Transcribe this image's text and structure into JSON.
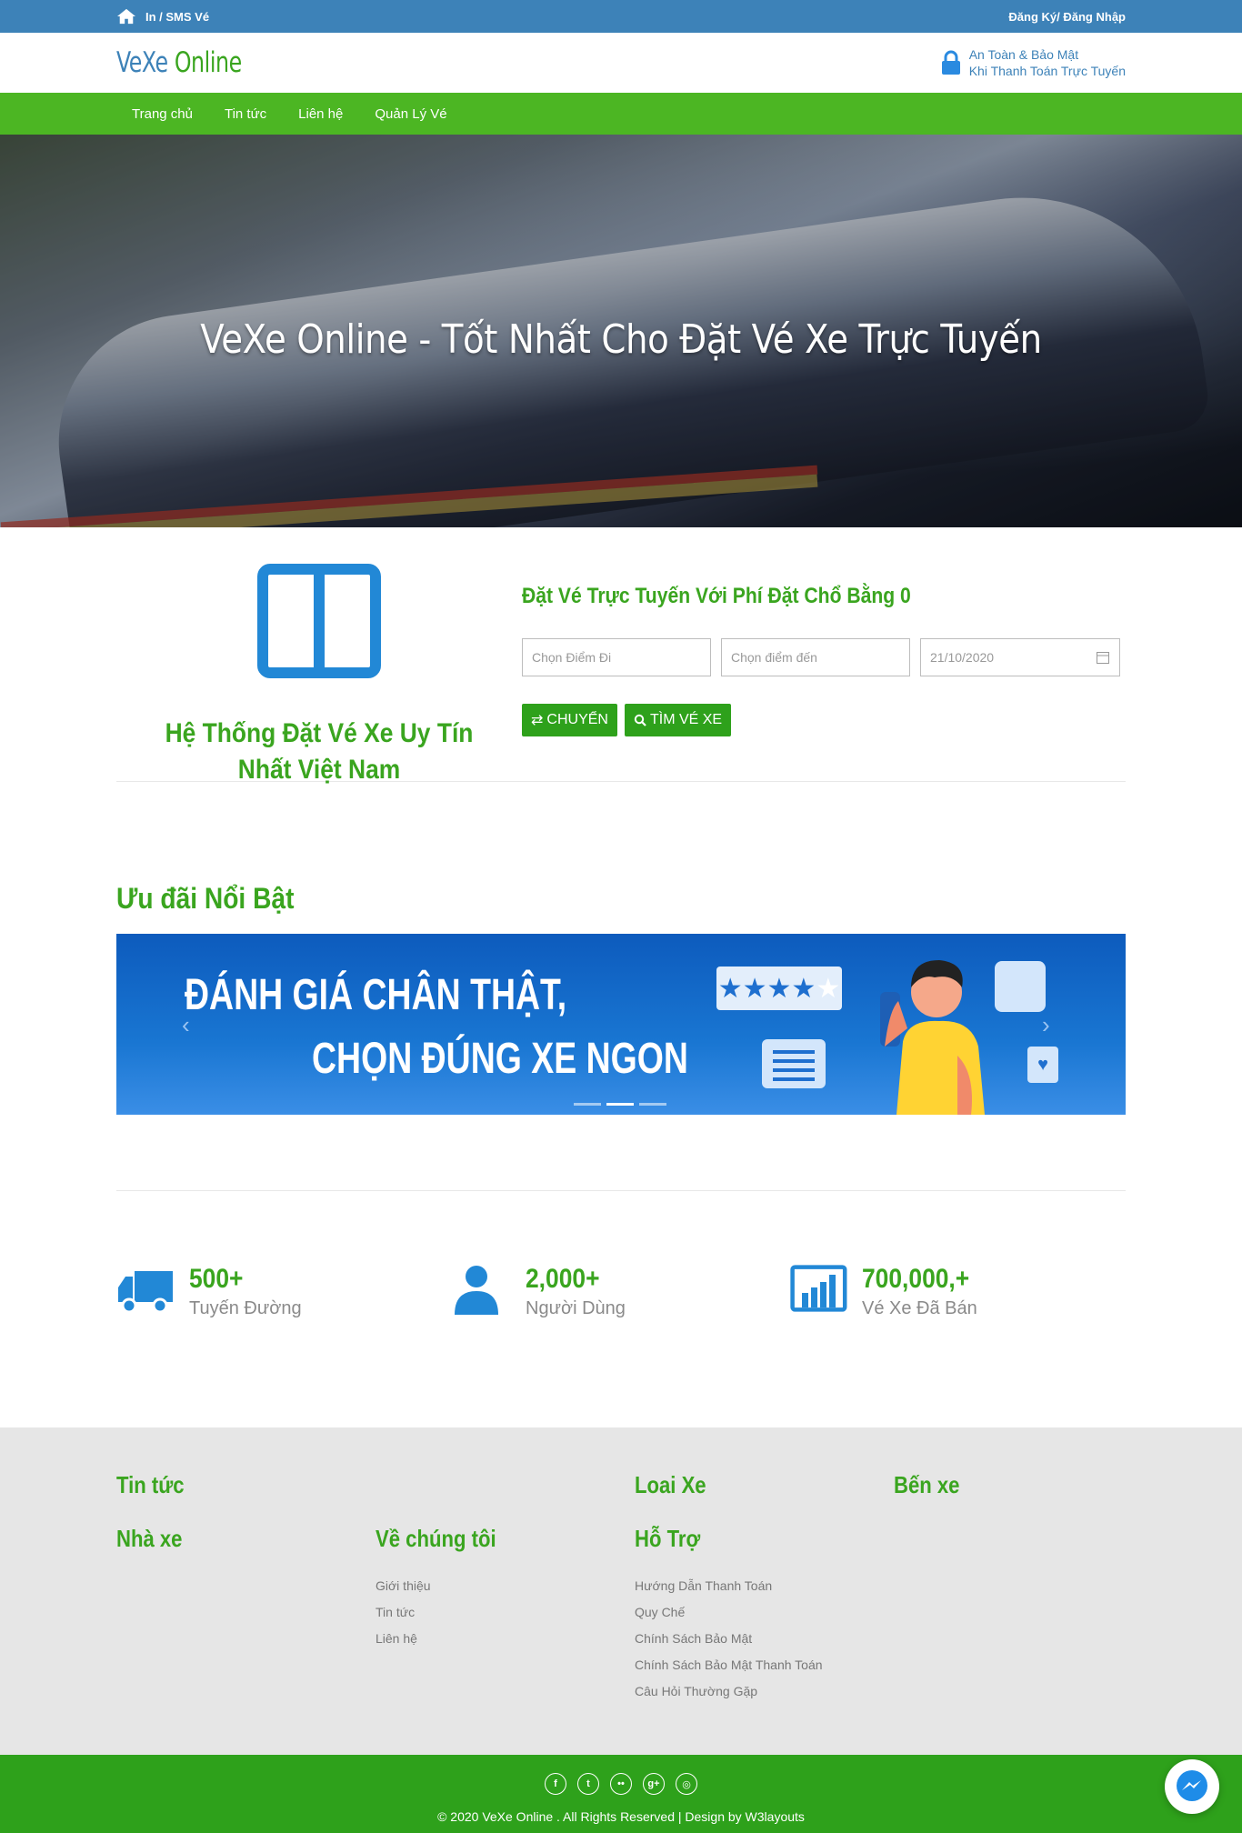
{
  "topbar": {
    "left_label": "In / SMS Vé",
    "right_label": "Đăng Ký/ Đăng Nhập"
  },
  "header": {
    "logo_part1": "VeXe",
    "logo_part2": "Online",
    "secure_line1": "An Toàn & Bảo Mật",
    "secure_line2": "Khi Thanh Toán Trực Tuyến"
  },
  "nav": {
    "items": [
      "Trang chủ",
      "Tin tức",
      "Liên hệ",
      "Quản Lý Vé"
    ]
  },
  "hero": {
    "title": "VeXe Online - Tốt Nhất Cho Đặt Vé Xe Trực Tuyến"
  },
  "booking": {
    "tagline": "Hệ Thống Đặt Vé Xe Uy Tín Nhất Việt Nam",
    "title": "Đặt Vé Trực Tuyến Với Phí Đặt Chổ Bằng 0",
    "from_placeholder": "Chọn Điểm Đi",
    "to_placeholder": "Chọn điểm đến",
    "date_value": "21/10/2020",
    "swap_label": "CHUYỂN",
    "search_label": "TÌM VÉ XE"
  },
  "promo": {
    "title": "Ưu đãi Nổi Bật",
    "banner_line1": "ĐÁNH GIÁ CHÂN THẬT,",
    "banner_line2": "CHỌN ĐÚNG XE NGON",
    "slide_count": 3,
    "active_slide": 2
  },
  "stats": [
    {
      "value": "500+",
      "label": "Tuyến Đường",
      "icon": "truck-icon"
    },
    {
      "value": "2,000+",
      "label": "Người Dùng",
      "icon": "user-icon"
    },
    {
      "value": "700,000,+",
      "label": "Vé Xe Đã Bán",
      "icon": "bar-chart-icon"
    }
  ],
  "footer": {
    "col1_heading1": "Tin tức",
    "col1_heading2": "Nhà xe",
    "col2_heading": "Về chúng tôi",
    "col2_links": [
      "Giới thiệu",
      "Tin tức",
      "Liên hệ"
    ],
    "col3_heading1": "Loai Xe",
    "col3_heading2": "Hỗ Trợ",
    "col3_links": [
      "Hướng Dẫn Thanh Toán",
      "Quy Chế",
      "Chính Sách Bảo Mật",
      "Chính Sách Bảo Mật Thanh Toán",
      "Câu Hỏi Thường Gặp"
    ],
    "col4_heading": "Bến xe"
  },
  "bottom": {
    "social": [
      "facebook-icon",
      "twitter-icon",
      "flickr-icon",
      "google-plus-icon",
      "dribbble-icon"
    ],
    "copyright": "© 2020 VeXe Online . All Rights Reserved | Design by W3layouts"
  },
  "colors": {
    "blue": "#3d82b8",
    "green": "#4cb623",
    "dark_green": "#2ea11b",
    "footer_bg": "#e6e6e6"
  }
}
